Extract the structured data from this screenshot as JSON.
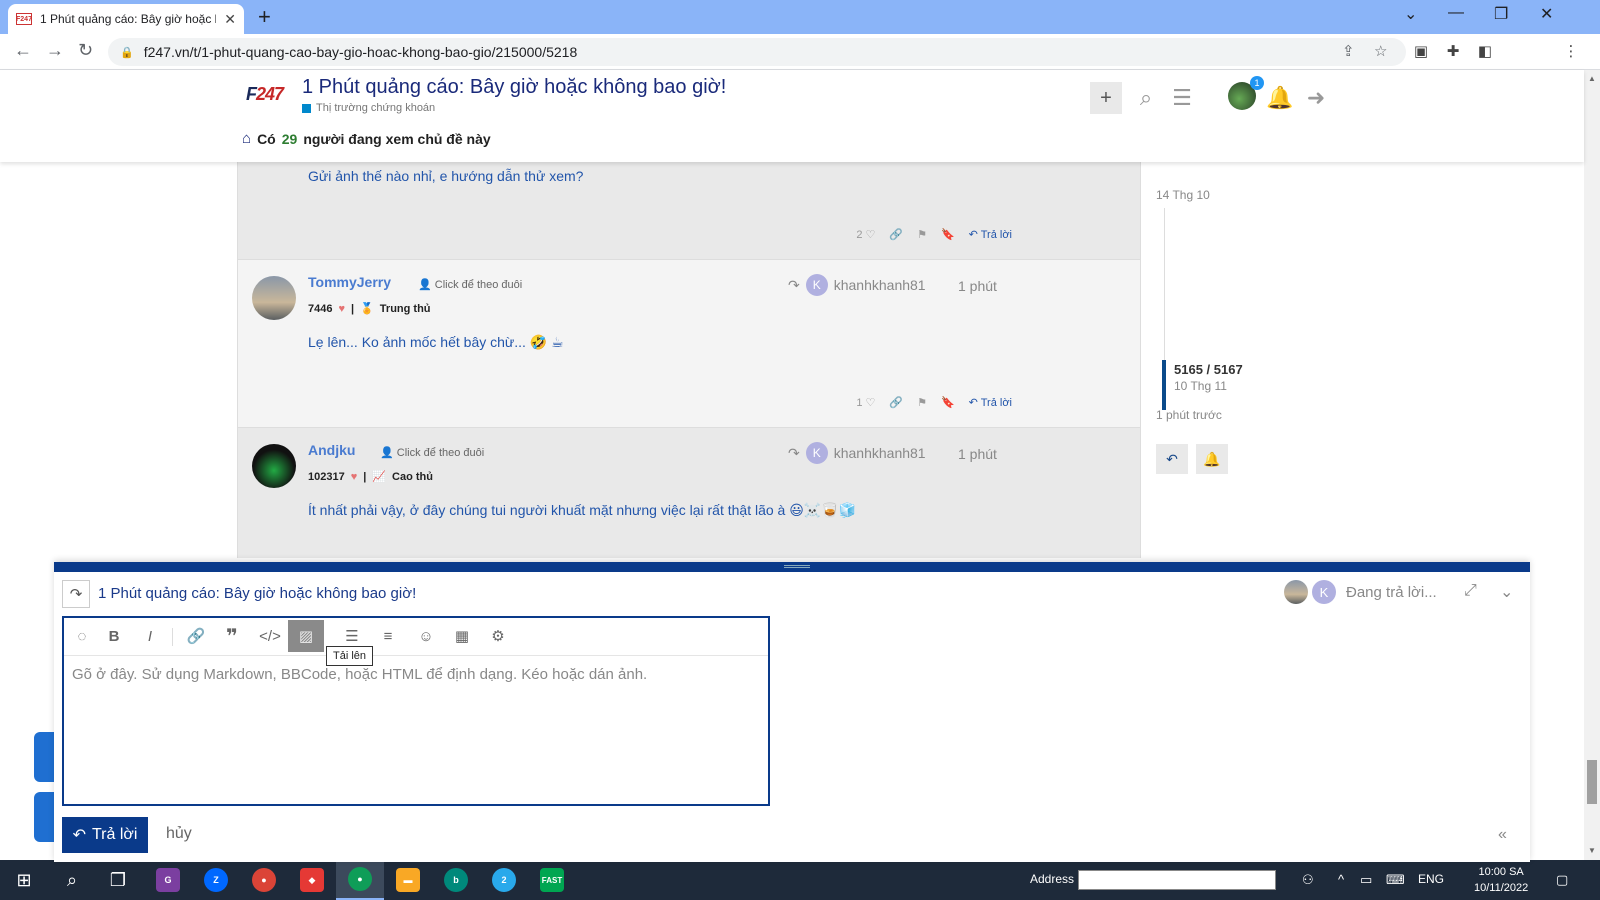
{
  "browser": {
    "tab_title": "1 Phút quảng cáo: Bây giờ hoặc k",
    "tab_favicon_text": "F247",
    "url": "f247.vn/t/1-phut-quang-cao-bay-gio-hoac-khong-bao-gio/215000/5218"
  },
  "header": {
    "logo_text": "F247",
    "topic_title": "1 Phút quảng cáo: Bây giờ hoặc không bao giờ!",
    "category": "Thị trường chứng khoán",
    "category_color": "#0088cc",
    "viewers_prefix": "Có",
    "viewers_count": "29",
    "viewers_suffix": "người đang xem chủ đề này",
    "notification_badge": "1"
  },
  "posts": [
    {
      "body": "Gửi ảnh thế nào nhỉ, e hướng dẫn thử xem?",
      "likes": "2",
      "reply_label": "Trả lời"
    },
    {
      "username": "TommyJerry",
      "follow_label": "Click để theo đuôi",
      "score": "7446",
      "rank": "Trung thủ",
      "reply_to": "khanhkhanh81",
      "reply_to_initial": "K",
      "time": "1 phút",
      "body": "Lẹ lên... Ko ảnh mốc hết bây chừ... 🤣 ☕",
      "likes": "1",
      "reply_label": "Trả lời"
    },
    {
      "username": "Andjku",
      "follow_label": "Click để theo đuôi",
      "score": "102317",
      "rank": "Cao thủ",
      "reply_to": "khanhkhanh81",
      "reply_to_initial": "K",
      "time": "1 phút",
      "body": "Ít nhất phải vậy, ở đây chúng tui người khuất mặt nhưng việc lại rất thật lão à 😃☠️🥃🧊"
    }
  ],
  "timeline": {
    "start_date": "14 Thg 10",
    "position": "5165 / 5167",
    "position_date": "10 Thg 11",
    "last_activity": "1 phút trước"
  },
  "composer": {
    "title": "1 Phút quảng cáo: Bây giờ hoặc không bao giờ!",
    "status": "Đang trả lời...",
    "status_initial": "K",
    "tooltip": "Tải lên",
    "placeholder": "Gõ ở đây. Sử dụng Markdown, BBCode, hoặc HTML để định dạng. Kéo hoặc dán ảnh.",
    "submit_label": "Trả lời",
    "cancel_label": "hủy"
  },
  "taskbar": {
    "address_label": "Address",
    "language": "ENG",
    "time": "10:00 SA",
    "date": "10/11/2022",
    "telegram_badge": "2"
  },
  "colors": {
    "brand": "#0a3a8a",
    "link": "#4a7bd0",
    "accent": "#8ab4f8"
  }
}
